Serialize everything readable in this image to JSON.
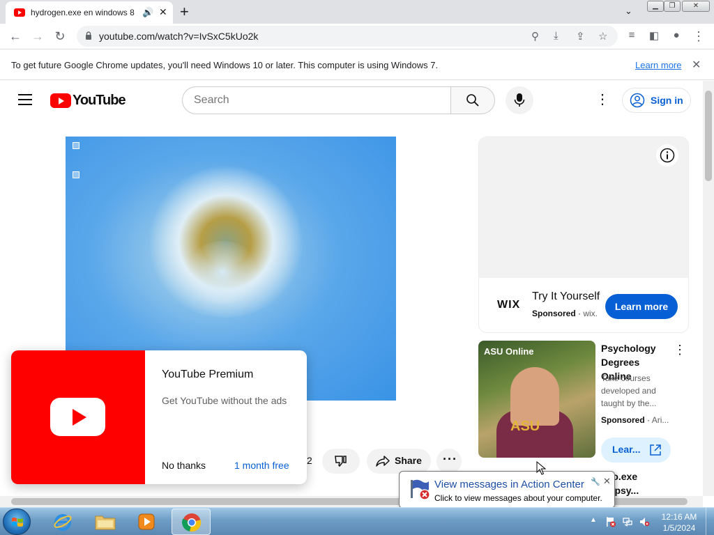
{
  "browser": {
    "tab_title": "hydrogen.exe en windows 8",
    "tab_audio_icon": "speaker-icon",
    "url": "youtube.com/watch?v=IvSxC5kUo2k",
    "infobar_message": "To get future Google Chrome updates, you'll need Windows 10 or later. This computer is using Windows 7.",
    "infobar_link": "Learn more",
    "window_controls": [
      "minimize",
      "restore",
      "close"
    ]
  },
  "youtube_header": {
    "logo_text": "YouTube",
    "search_placeholder": "Search",
    "sign_in_label": "Sign in"
  },
  "video": {
    "like_count_partial": "2",
    "share_label": "Share"
  },
  "premium_popup": {
    "title": "YouTube Premium",
    "subtitle": "Get YouTube without the ads",
    "decline_label": "No thanks",
    "trial_label": "1 month free"
  },
  "ad_card": {
    "brand": "WIX",
    "headline": "Try It Yourself",
    "sponsored_label": "Sponsored",
    "domain": "wix.",
    "cta_label": "Learn more"
  },
  "promoted_item": {
    "thumb_brand": "ASU Online",
    "thumb_shirt_text": "ASU",
    "title": "Psychology Degrees Online",
    "description": "Take courses developed and taught by the...",
    "sponsored_label": "Sponsored",
    "domain": "Ari...",
    "cta_label": "Lear...",
    "next_title": "...to.exe ...epsy..."
  },
  "balloon": {
    "title": "View messages in Action Center",
    "text": "Click to view messages about your computer."
  },
  "taskbar": {
    "apps": [
      "internet-explorer",
      "windows-explorer",
      "media-player",
      "google-chrome"
    ],
    "active_app": "google-chrome",
    "clock_time": "12:16 AM",
    "clock_date": "1/5/2024"
  },
  "colors": {
    "youtube_red": "#ff0000",
    "link_blue": "#065fd4",
    "chrome_link": "#1a73e8",
    "taskbar_blue": "#6d9cc5"
  }
}
